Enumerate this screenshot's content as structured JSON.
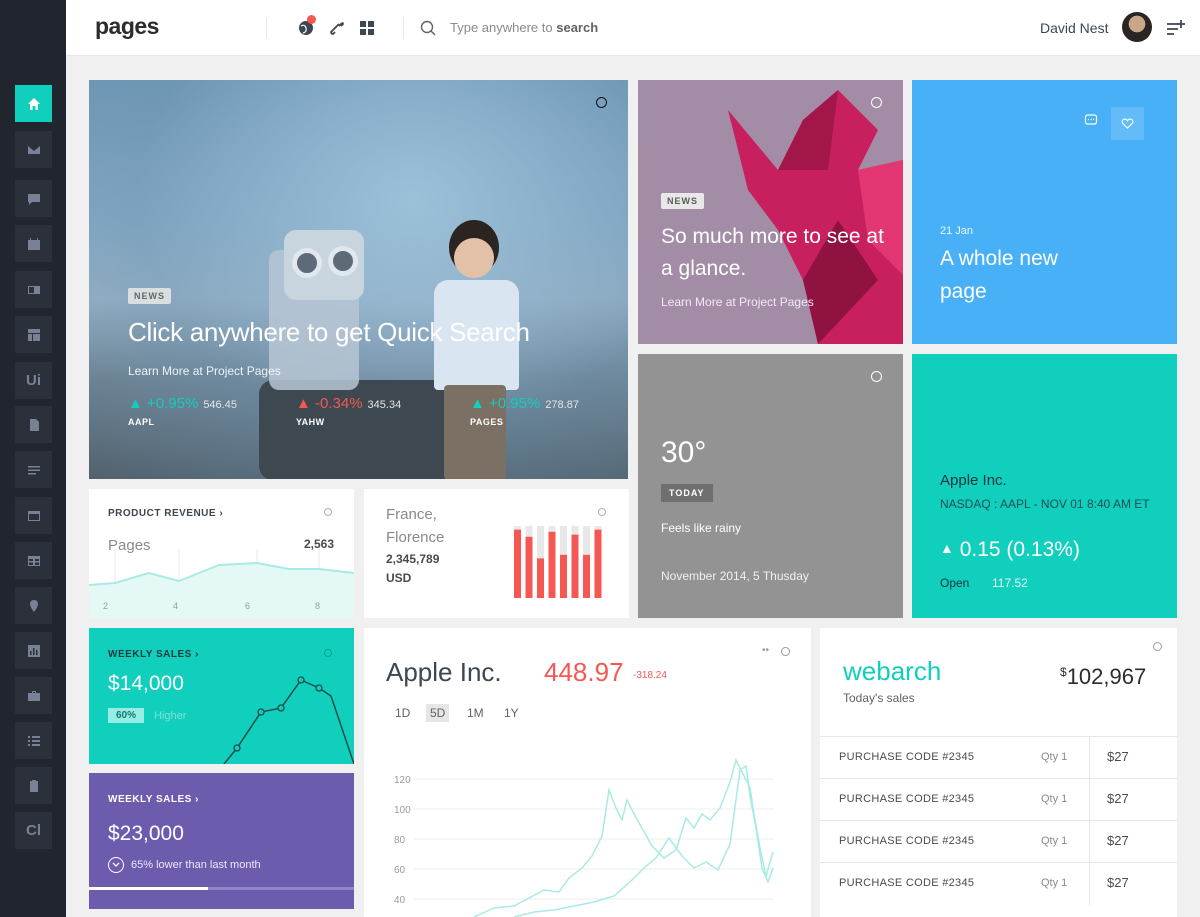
{
  "header": {
    "logo": "pages",
    "search_placeholder": "Type anywhere to ",
    "search_bold": "search",
    "username": "David Nest"
  },
  "sidebar": {
    "items": [
      {
        "icon": "home-icon",
        "active": true
      },
      {
        "icon": "mail-icon"
      },
      {
        "icon": "chat-icon"
      },
      {
        "icon": "calendar-icon"
      },
      {
        "icon": "layout-icon"
      },
      {
        "icon": "builder-icon"
      },
      {
        "label": "Ui"
      },
      {
        "icon": "file-icon"
      },
      {
        "icon": "form-icon"
      },
      {
        "icon": "window-icon"
      },
      {
        "icon": "table-icon"
      },
      {
        "icon": "map-pin-icon"
      },
      {
        "icon": "chart-icon"
      },
      {
        "icon": "briefcase-icon"
      },
      {
        "icon": "list-icon"
      },
      {
        "icon": "clipboard-icon"
      },
      {
        "label": "Cl"
      }
    ]
  },
  "hero": {
    "badge": "NEWS",
    "title": "Click anywhere to get Quick Search",
    "subtitle": "Learn More at Project Pages",
    "tickers": [
      {
        "delta": "+0.95%",
        "value": "546.45",
        "symbol": "AAPL",
        "dir": "up"
      },
      {
        "delta": "-0.34%",
        "value": "345.34",
        "symbol": "YAHW",
        "dir": "down"
      },
      {
        "delta": "+0.95%",
        "value": "278.87",
        "symbol": "PAGES",
        "dir": "up"
      }
    ]
  },
  "origami": {
    "badge": "NEWS",
    "title": "So much more to see at a glance.",
    "subtitle": "Learn More at Project Pages"
  },
  "blue_card": {
    "date": "21 Jan",
    "line1": "A whole new",
    "line2": "page"
  },
  "weather": {
    "temp": "30°",
    "badge": "TODAY",
    "desc": "Feels like rainy",
    "date": "November 2014, 5 Thusday"
  },
  "stock": {
    "name": "Apple Inc.",
    "exchange": "NASDAQ : AAPL - NOV 01 8:40 AM ET",
    "delta": "0.15 (0.13%)",
    "open_label": "Open",
    "open_value": "117.52"
  },
  "revenue": {
    "title": "PRODUCT REVENUE",
    "label": "Pages",
    "value": "2,563",
    "ticks": [
      "2",
      "4",
      "6",
      "8"
    ]
  },
  "france": {
    "city1": "France,",
    "city2": "Florence",
    "value": "2,345,789",
    "currency": "USD",
    "bars": [
      0.95,
      0.85,
      0.55,
      0.92,
      0.6,
      0.88,
      0.6,
      0.95
    ]
  },
  "weekly_sales_1": {
    "title": "WEEKLY SALES",
    "value": "$14,000",
    "pct": "60%",
    "note": "Higher"
  },
  "weekly_sales_2": {
    "title": "WEEKLY SALES",
    "value": "$23,000",
    "note": "65% lower than last month",
    "progress": 0.45
  },
  "apple": {
    "title": "Apple Inc.",
    "price": "448.97",
    "change": "-318.24",
    "ranges": [
      "1D",
      "5D",
      "1M",
      "1Y"
    ],
    "selected_range": "5D",
    "y_ticks": [
      "120",
      "100",
      "80",
      "60",
      "40"
    ]
  },
  "webarch": {
    "title": "webarch",
    "subtitle": "Today's sales",
    "amount_symbol": "$",
    "amount": "102,967",
    "rows": [
      {
        "code": "PURCHASE CODE #2345",
        "qty": "Qty 1",
        "price": "$27"
      },
      {
        "code": "PURCHASE CODE #2345",
        "qty": "Qty 1",
        "price": "$27"
      },
      {
        "code": "PURCHASE CODE #2345",
        "qty": "Qty 1",
        "price": "$27"
      },
      {
        "code": "PURCHASE CODE #2345",
        "qty": "Qty 1",
        "price": "$27"
      }
    ]
  },
  "colors": {
    "accent": "#10cfbd",
    "danger": "#f55753",
    "blue": "#48b0f7",
    "purple": "#6d5cae",
    "sidebar": "#21252d"
  }
}
